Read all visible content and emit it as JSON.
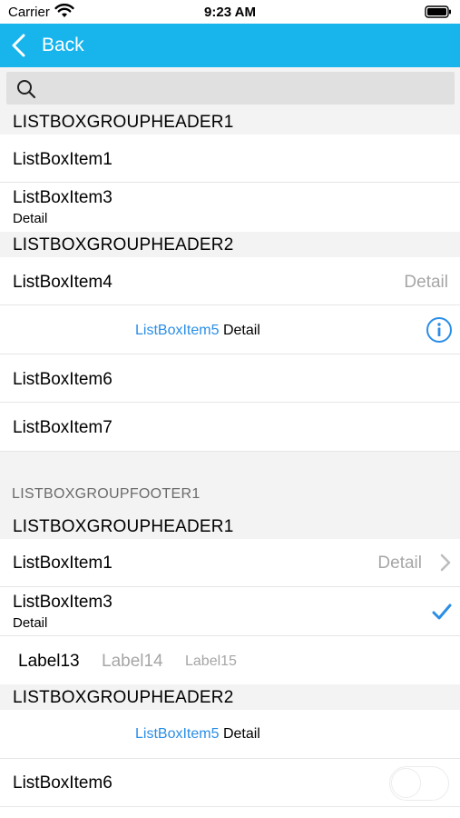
{
  "status_bar": {
    "carrier": "Carrier",
    "time": "9:23 AM"
  },
  "nav": {
    "back_label": "Back"
  },
  "search": {
    "value": "",
    "placeholder": ""
  },
  "sections": {
    "header1_a": "LISTBOXGROUPHEADER1",
    "item1_a": "ListBoxItem1",
    "item3_a": "ListBoxItem3",
    "item3_a_detail": "Detail",
    "header2_a": "LISTBOXGROUPHEADER2",
    "item4": "ListBoxItem4",
    "item4_detail": "Detail",
    "item5_a_title": "ListBoxItem5",
    "item5_a_detail": "Detail",
    "item6_a": "ListBoxItem6",
    "item7": "ListBoxItem7",
    "footer1": "LISTBOXGROUPFOOTER1",
    "header1_b": "LISTBOXGROUPHEADER1",
    "item1_b": "ListBoxItem1",
    "item1_b_detail": "Detail",
    "item3_b": "ListBoxItem3",
    "item3_b_detail": "Detail",
    "label13": "Label13",
    "label14": "Label14",
    "label15": "Label15",
    "header2_b": "LISTBOXGROUPHEADER2",
    "item5_b_title": "ListBoxItem5",
    "item5_b_detail": "Detail",
    "item6_b": "ListBoxItem6"
  },
  "icons": {
    "wifi": "wifi-icon",
    "battery": "battery-icon",
    "back": "chevron-left-icon",
    "search": "search-icon",
    "info": "info-icon",
    "chevron": "chevron-right-icon",
    "check": "checkmark-icon"
  },
  "colors": {
    "nav_bar": "#18b4ec",
    "accent_blue": "#2a8ee6",
    "group_bg": "#f3f3f3",
    "detail_gray": "#a6a6a6"
  },
  "toggle_item6": {
    "on": false
  }
}
